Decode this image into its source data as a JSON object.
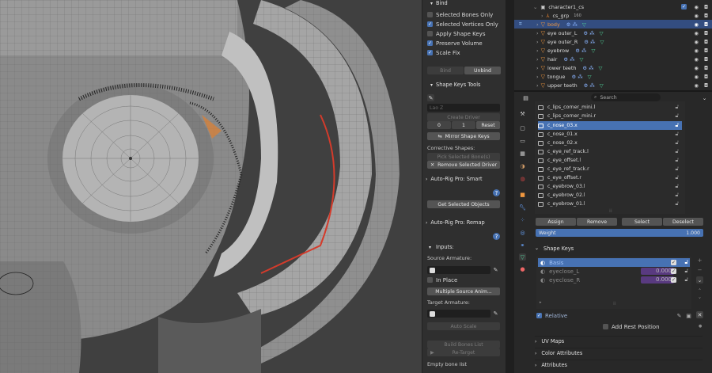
{
  "npanel": {
    "bind_header": "Bind",
    "checks": [
      {
        "label": "Selected Bones Only",
        "checked": false
      },
      {
        "label": "Selected Vertices Only",
        "checked": true
      },
      {
        "label": "Apply Shape Keys",
        "checked": false
      },
      {
        "label": "Preserve Volume",
        "checked": true
      },
      {
        "label": "Scale Fix",
        "checked": true
      }
    ],
    "bind_btn": "Bind",
    "unbind_btn": "Unbind",
    "shape_keys_tools": "Shape Keys Tools",
    "bone_field": "Lao Z",
    "create_driver": "Create Driver",
    "val0": "0",
    "val1": "1",
    "reset": "Reset",
    "mirror_shape_keys": "Mirror Shape Keys",
    "corrective_shapes": "Corrective Shapes:",
    "pick_selected_bones": "Pick Selected Bone(s)",
    "remove_selected_driver": "Remove Selected Driver",
    "smart_header": "Auto-Rig Pro: Smart",
    "get_selected_objects": "Get Selected Objects",
    "remap_header": "Auto-Rig Pro: Remap",
    "inputs": "Inputs:",
    "source_armature": "Source Armature:",
    "in_place": "In Place",
    "multiple_source": "Multiple Source Anim...",
    "target_armature": "Target Armature:",
    "auto_scale": "Auto Scale",
    "build_bones_list": "Build Bones List",
    "re_target": "Re-Target",
    "empty_bone_list": "Empty bone list"
  },
  "outliner": {
    "rows": [
      {
        "name": "character1_cs",
        "selected": false
      },
      {
        "name": "cs_grp",
        "selected": false
      },
      {
        "name": "body",
        "selected": true
      },
      {
        "name": "eye outer_L",
        "selected": false
      },
      {
        "name": "eye outer_R",
        "selected": false
      },
      {
        "name": "eyebrow",
        "selected": false
      },
      {
        "name": "hair",
        "selected": false
      },
      {
        "name": "lower teeth",
        "selected": false
      },
      {
        "name": "tongue",
        "selected": false
      },
      {
        "name": "upper teeth",
        "selected": false
      }
    ],
    "badge": "160"
  },
  "props": {
    "search_placeholder": "Search",
    "groups": [
      {
        "name": "c_lips_corner_mini.l",
        "selected": false
      },
      {
        "name": "c_lips_corner_mini.r",
        "selected": false
      },
      {
        "name": "c_nose_03.x",
        "selected": true
      },
      {
        "name": "c_nose_01.x",
        "selected": false
      },
      {
        "name": "c_nose_02.x",
        "selected": false
      },
      {
        "name": "c_eye_ref_track.l",
        "selected": false
      },
      {
        "name": "c_eye_offset.l",
        "selected": false
      },
      {
        "name": "c_eye_ref_track.r",
        "selected": false
      },
      {
        "name": "c_eye_offset.r",
        "selected": false
      },
      {
        "name": "c_eyebrow_03.l",
        "selected": false
      },
      {
        "name": "c_eyebrow_02.l",
        "selected": false
      },
      {
        "name": "c_eyebrow_01.l",
        "selected": false
      }
    ],
    "assign": "Assign",
    "remove": "Remove",
    "select": "Select",
    "deselect": "Deselect",
    "weight_label": "Weight",
    "weight_value": "1.000",
    "shape_keys_header": "Shape Keys",
    "shape_keys": [
      {
        "name": "Basis",
        "value": ""
      },
      {
        "name": "eyeclose_L",
        "value": "0.000"
      },
      {
        "name": "eyeclose_R",
        "value": "0.000"
      }
    ],
    "relative": "Relative",
    "add_rest_position": "Add Rest Position",
    "uv_maps": "UV Maps",
    "color_attributes": "Color Attributes",
    "attributes": "Attributes",
    "accent": "#4772b3"
  }
}
